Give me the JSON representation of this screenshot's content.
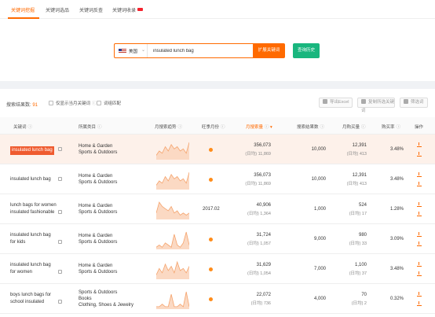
{
  "tabs": [
    {
      "label": "关键词挖掘",
      "active": true
    },
    {
      "label": "关键词选品",
      "active": false
    },
    {
      "label": "关键词反查",
      "active": false
    },
    {
      "label": "关键词收录",
      "active": false,
      "badge": "new"
    }
  ],
  "search": {
    "country": "美国",
    "keyword": "insulated lunch bag",
    "search_button": "扩展关键词",
    "history_button": "查询历史"
  },
  "filters": {
    "result_label": "搜索结果数:",
    "result_count": "91",
    "only_current": "仅显示当月关键词",
    "fuzzy_match": "词组匹配"
  },
  "tools": {
    "export": "导出Excel",
    "copy": "复制所选关键词",
    "filter": "筛选词"
  },
  "columns": {
    "keyword": "关键词",
    "category": "所属类目",
    "trend": "月搜索趋势",
    "season": "旺季月份",
    "monthly_search": "月搜索量",
    "search_results": "搜索结果数",
    "monthly_purchase": "月购买量",
    "purchase_rate": "购买率",
    "actions": "操作"
  },
  "rows": [
    {
      "keyword": [
        "insulated lunch bag"
      ],
      "categories": [
        "Home & Garden",
        "Sports & Outdoors"
      ],
      "season": "",
      "monthly_search": "356,073",
      "daily_search": "(日均) 11,869",
      "search_results": "10,000",
      "monthly_purchase": "12,391",
      "daily_purchase": "(日均) 413",
      "purchase_rate": "3.48%",
      "highlight": true,
      "trend": [
        2,
        4,
        3,
        6,
        4,
        7,
        5,
        6,
        4,
        5,
        3,
        8
      ]
    },
    {
      "keyword": [
        "insulated lunch bag"
      ],
      "categories": [
        "Home & Garden",
        "Sports & Outdoors"
      ],
      "season": "",
      "monthly_search": "356,073",
      "daily_search": "(日均) 11,869",
      "search_results": "10,000",
      "monthly_purchase": "12,391",
      "daily_purchase": "(日均) 413",
      "purchase_rate": "3.48%",
      "highlight": false,
      "trend": [
        2,
        4,
        3,
        6,
        4,
        7,
        5,
        6,
        4,
        5,
        3,
        8
      ]
    },
    {
      "keyword": [
        "lunch bags for women",
        "insulated fashionable"
      ],
      "categories": [
        "Home & Garden",
        "Sports & Outdoors"
      ],
      "season": "2017.02",
      "monthly_search": "40,906",
      "daily_search": "(日均) 1,364",
      "search_results": "1,000",
      "monthly_purchase": "524",
      "daily_purchase": "(日均) 17",
      "purchase_rate": "1.28%",
      "highlight": false,
      "trend": [
        3,
        8,
        6,
        5,
        4,
        6,
        3,
        4,
        2,
        3,
        2,
        3
      ]
    },
    {
      "keyword": [
        "insulated lunch bag",
        "for kids"
      ],
      "categories": [
        "Home & Garden",
        "Sports & Outdoors"
      ],
      "season": "",
      "monthly_search": "31,724",
      "daily_search": "(日均) 1,057",
      "search_results": "9,000",
      "monthly_purchase": "980",
      "daily_purchase": "(日均) 33",
      "purchase_rate": "3.09%",
      "highlight": false,
      "trend": [
        1,
        2,
        1,
        3,
        2,
        1,
        7,
        2,
        1,
        3,
        8,
        2
      ]
    },
    {
      "keyword": [
        "insulated lunch bag",
        "for women"
      ],
      "categories": [
        "Home & Garden",
        "Sports & Outdoors"
      ],
      "season": "",
      "monthly_search": "31,629",
      "daily_search": "(日均) 1,054",
      "search_results": "7,000",
      "monthly_purchase": "1,100",
      "daily_purchase": "(日均) 37",
      "purchase_rate": "3.48%",
      "highlight": false,
      "trend": [
        2,
        5,
        3,
        7,
        4,
        6,
        3,
        8,
        4,
        5,
        3,
        6
      ]
    },
    {
      "keyword": [
        "boys lunch bags for",
        "school insulated"
      ],
      "categories": [
        "Sports & Outdoors",
        "Books",
        "Clothing, Shoes & Jewelry"
      ],
      "season": "",
      "monthly_search": "22,072",
      "daily_search": "(日均) 736",
      "search_results": "4,000",
      "monthly_purchase": "70",
      "daily_purchase": "(日均) 2",
      "purchase_rate": "0.32%",
      "highlight": false,
      "trend": [
        1,
        1,
        2,
        1,
        1,
        6,
        1,
        1,
        2,
        1,
        7,
        1
      ]
    }
  ],
  "colors": {
    "accent": "#ff6a00",
    "green": "#19b67e",
    "highlight_row": "#fdf1ea"
  }
}
